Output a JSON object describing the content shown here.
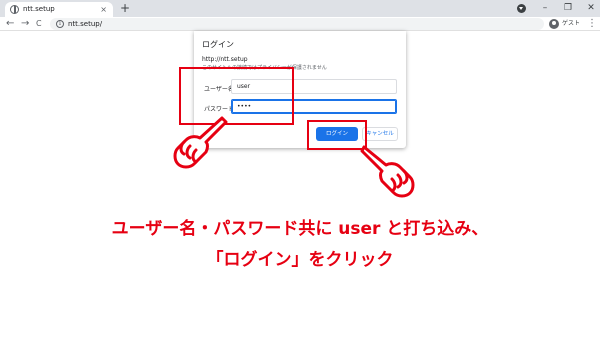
{
  "browser": {
    "tab_title": "ntt.setup",
    "tab_close": "×",
    "new_tab": "+",
    "minimize": "–",
    "restore": "❐",
    "close": "✕",
    "back": "←",
    "forward": "→",
    "reload": "C",
    "url": "ntt.setup/",
    "profile_label": "ゲスト",
    "menu": "⋮"
  },
  "dialog": {
    "title": "ログイン",
    "url": "http://ntt.setup",
    "note": "このサイトへの接続ではプライバシーが保護されません",
    "username_label": "ユーザー名",
    "username_value": "user",
    "password_label": "パスワード",
    "password_value": "••••",
    "login_button": "ログイン",
    "cancel_button": "キャンセル"
  },
  "instructions": {
    "line1": "ユーザー名・パスワード共に user と打ち込み、",
    "line2": "「ログイン」をクリック"
  },
  "colors": {
    "accent_red": "#e60012",
    "button_blue": "#1a73e8"
  }
}
